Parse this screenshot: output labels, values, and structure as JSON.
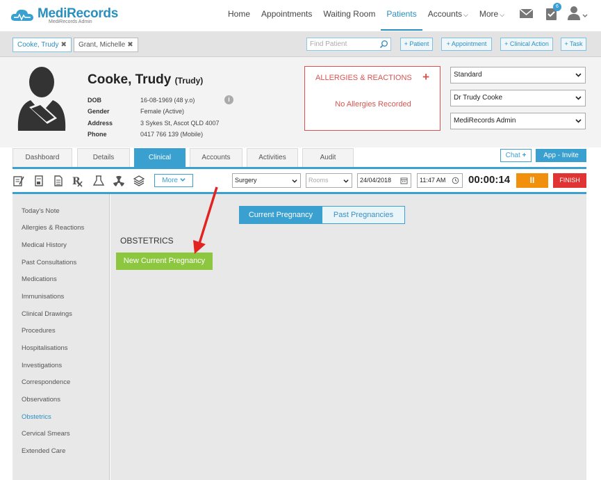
{
  "app": {
    "logo_text": "MediRecords",
    "logo_subtitle": "MediRecords Admin"
  },
  "nav": {
    "items": [
      {
        "label": "Home"
      },
      {
        "label": "Appointments"
      },
      {
        "label": "Waiting Room"
      },
      {
        "label": "Patients"
      },
      {
        "label": "Accounts"
      },
      {
        "label": "More"
      }
    ],
    "notification_count": "6",
    "active": "Patients"
  },
  "patient_tabs": [
    {
      "label": "Cooke, Trudy"
    },
    {
      "label": "Grant, Michelle"
    }
  ],
  "find_patient": {
    "placeholder": "Find Patient",
    "value": ""
  },
  "actions": {
    "patient": "+ Patient",
    "appointment": "+ Appointment",
    "clinical_action": "+ Clinical Action",
    "task": "+ Task"
  },
  "patient": {
    "name": "Cooke, Trudy",
    "preferred": "(Trudy)",
    "fields": [
      {
        "label": "DOB",
        "value": "16-08-1969 (48 y.o)"
      },
      {
        "label": "Gender",
        "value": "Female (Active)"
      },
      {
        "label": "Address",
        "value": "3 Sykes St, Ascot QLD 4007"
      },
      {
        "label": "Phone",
        "value": "0417 766 139 (Mobile)"
      }
    ],
    "info_glyph": "i"
  },
  "allergies": {
    "title": "ALLERGIES & REACTIONS",
    "add_glyph": "+",
    "status": "No Allergies Recorded"
  },
  "selects": {
    "billing": "Standard",
    "doctor": "Dr Trudy Cooke",
    "location": "MediRecords Admin"
  },
  "main_tabs": [
    {
      "label": "Dashboard"
    },
    {
      "label": "Details"
    },
    {
      "label": "Clinical"
    },
    {
      "label": "Accounts"
    },
    {
      "label": "Activities"
    },
    {
      "label": "Audit"
    }
  ],
  "main_tabs_active": "Clinical",
  "chat": {
    "label": "Chat",
    "plus": "+"
  },
  "app_invite": "App - Invite",
  "toolbar": {
    "more_label": "More",
    "visit_type": "Surgery",
    "rooms_placeholder": "Rooms",
    "date": "24/04/2018",
    "time": "11:47 AM",
    "timer": "00:00:14",
    "pause_glyph": "II",
    "finish_label": "FINISH"
  },
  "sidebar": {
    "items": [
      {
        "label": "Today's Note"
      },
      {
        "label": "Allergies & Reactions"
      },
      {
        "label": "Medical History"
      },
      {
        "label": "Past Consultations"
      },
      {
        "label": "Medications"
      },
      {
        "label": "Immunisations"
      },
      {
        "label": "Clinical Drawings"
      },
      {
        "label": "Procedures"
      },
      {
        "label": "Hospitalisations"
      },
      {
        "label": "Investigations"
      },
      {
        "label": "Correspondence"
      },
      {
        "label": "Observations"
      },
      {
        "label": "Obstetrics"
      },
      {
        "label": "Cervical Smears"
      },
      {
        "label": "Extended Care"
      }
    ],
    "active": "Obstetrics"
  },
  "content": {
    "segments": [
      {
        "label": "Current Pregnancy"
      },
      {
        "label": "Past Pregnancies"
      }
    ],
    "section_title": "OBSTETRICS",
    "new_button": "New Current Pregnancy"
  },
  "colors": {
    "accent": "#3aa0cf",
    "brand_green": "#5aa93a",
    "danger": "#d9534f",
    "warning": "#f0900d",
    "success": "#8dc63f"
  }
}
